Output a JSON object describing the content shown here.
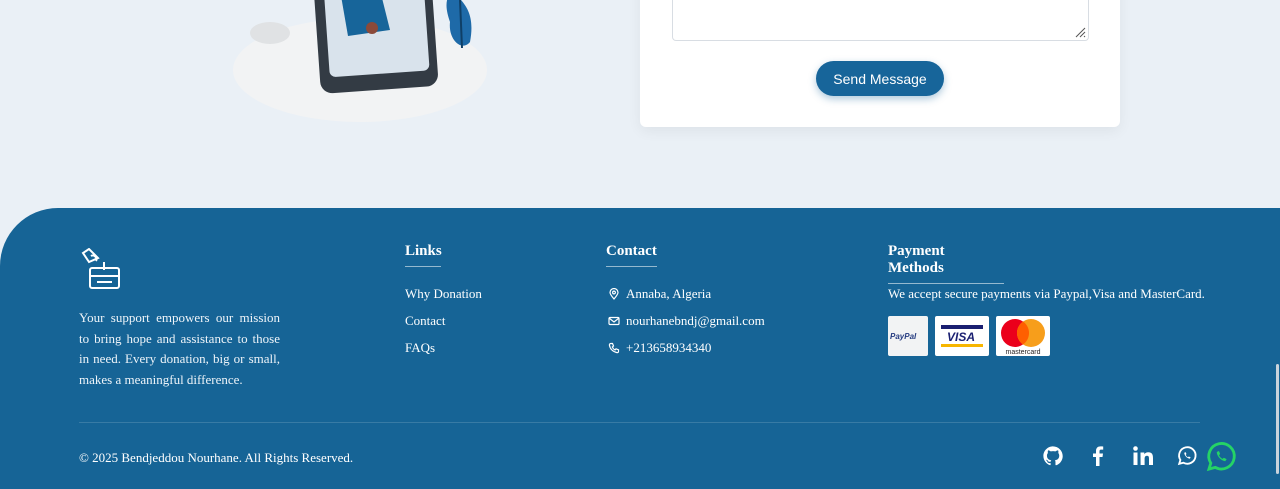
{
  "form": {
    "send_label": "Send Message"
  },
  "footer": {
    "about": "Your support empowers our mission to bring hope and assistance to those in need. Every donation, big or small, makes a meaningful difference.",
    "links": {
      "title": "Links",
      "items": [
        "Why Donation",
        "Contact",
        "FAQs"
      ]
    },
    "contact": {
      "title": "Contact",
      "address": "Annaba, Algeria",
      "email": "nourhanebndj@gmail.com",
      "phone": "+213658934340"
    },
    "payment": {
      "title": "Payment Methods",
      "text": "We accept secure payments via Paypal,Visa and MasterCard.",
      "logos": [
        "PayPal",
        "VISA",
        "mastercard"
      ]
    },
    "copyright": "© 2025 Bendjeddou Nourhane. All Rights Reserved.",
    "social": [
      "github-icon",
      "facebook-icon",
      "linkedin-icon",
      "whatsapp-icon"
    ]
  },
  "colors": {
    "primary": "#166496",
    "page_bg": "#eaf0f6",
    "whatsapp": "#25d366"
  }
}
